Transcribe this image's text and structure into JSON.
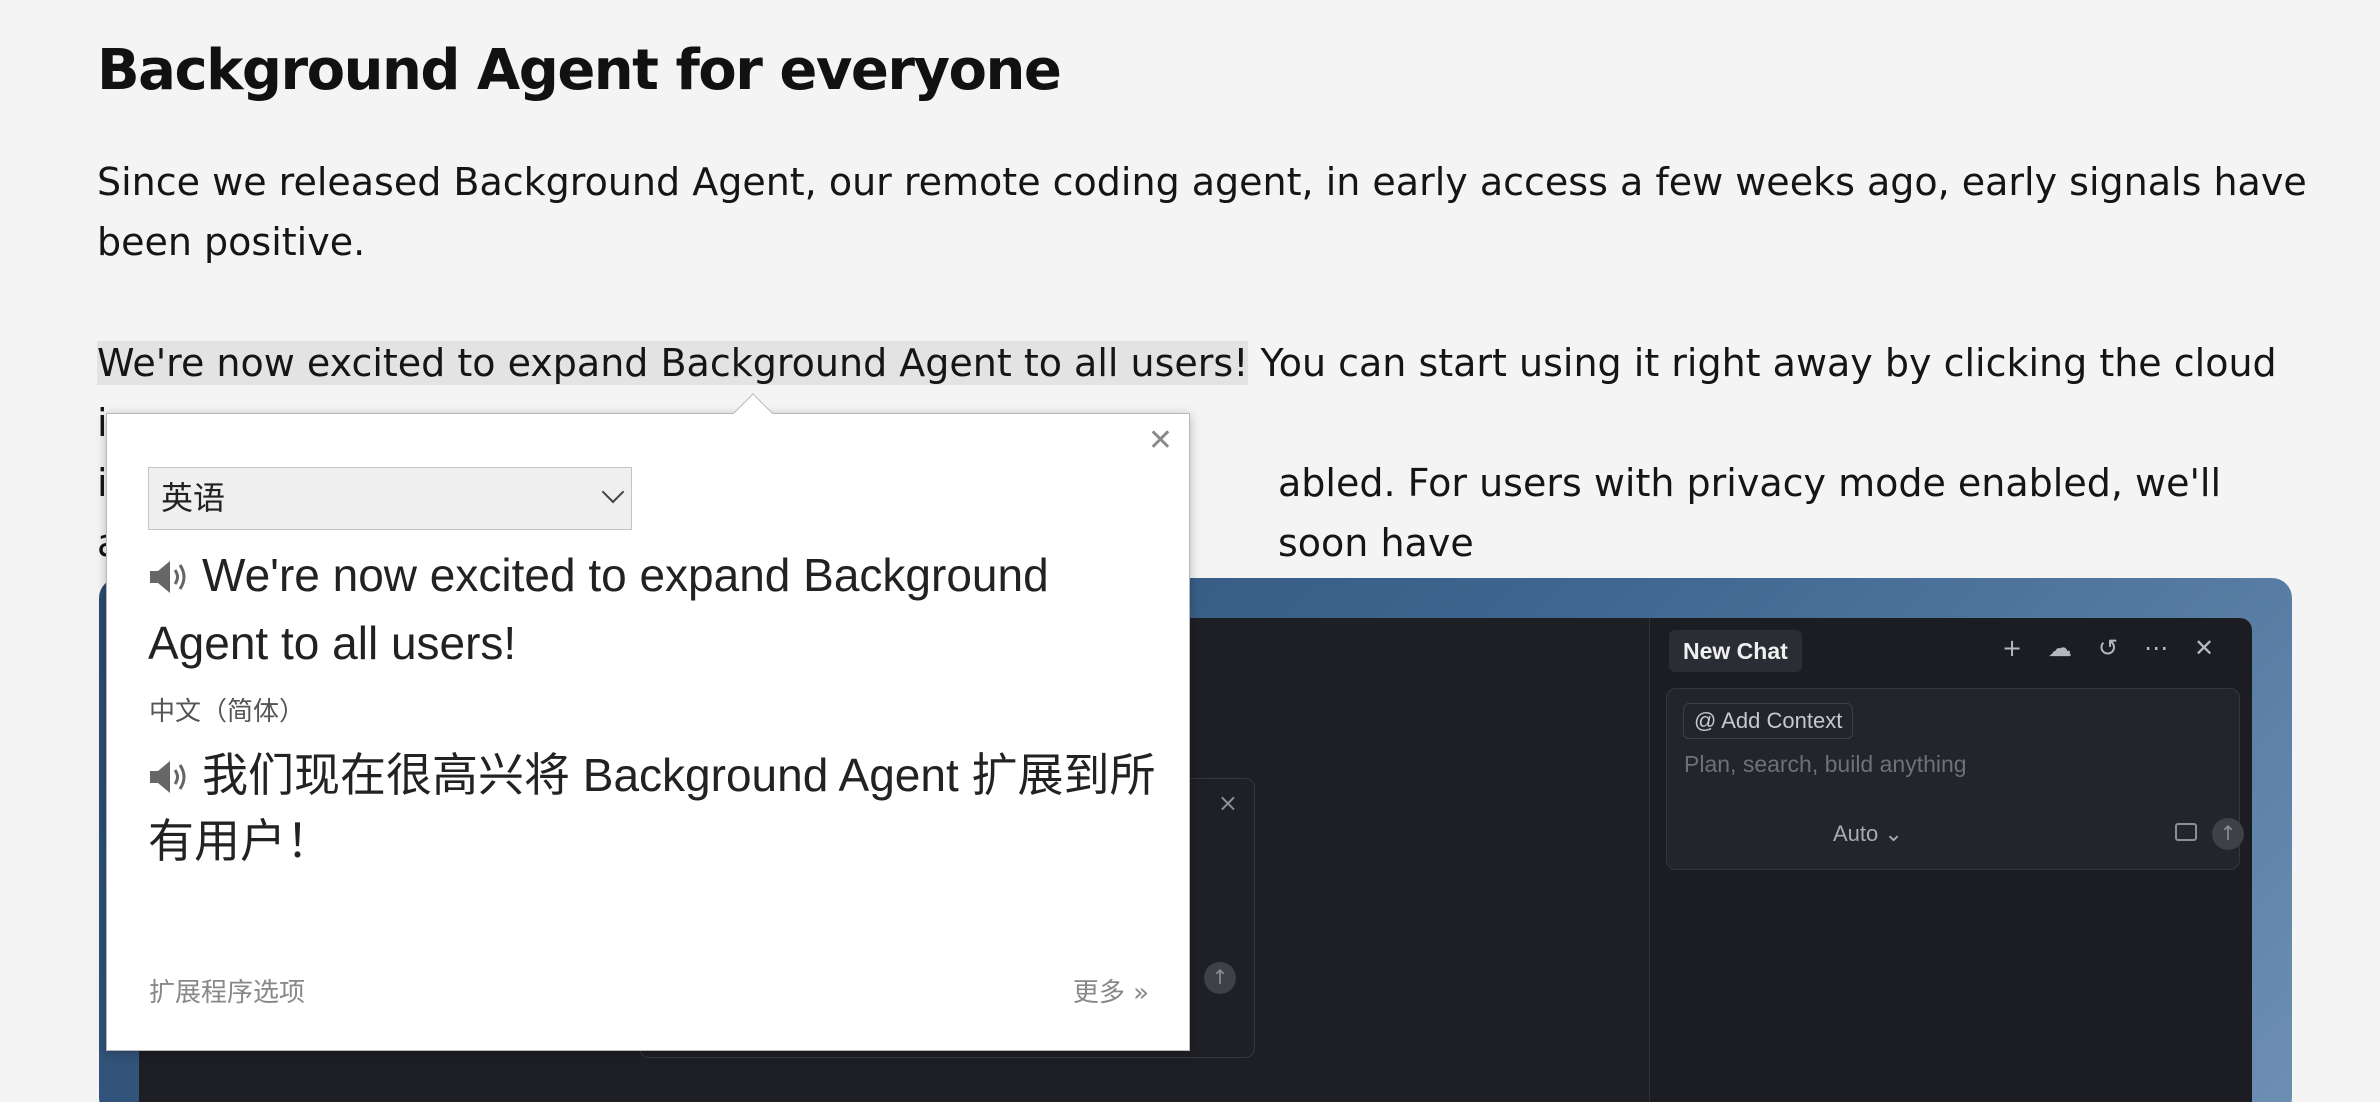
{
  "article": {
    "title": "Background Agent for everyone",
    "p1": "Since we released Background Agent, our remote coding agent, in early access a few weeks ago, early signals have been positive.",
    "p2_highlight": "We're now excited to expand Background Agent to all users!",
    "p2_line1_rest": " You can start using it right away by clicking the cloud icon",
    "p2_line2_start": "i",
    "p2_line2_visible": "abled. For users with privacy mode enabled, we'll soon have",
    "p2_line3_start": "a"
  },
  "screenshot": {
    "chat_tab": "New Chat",
    "add_context": "@ Add Context",
    "placeholder": "Plan, search, build anything",
    "mode": "Auto ⌄",
    "icons": [
      "plus-icon",
      "cloud-icon",
      "history-icon",
      "more-icon",
      "close-icon"
    ]
  },
  "popup": {
    "source_language": "英语",
    "source_text": "We're now excited to expand Background Agent to all users!",
    "target_language": "中文（简体）",
    "target_text": "我们现在很高兴将 Background Agent 扩展到所有用户！",
    "options_link": "扩展程序选项",
    "more_link": "更多 »"
  }
}
